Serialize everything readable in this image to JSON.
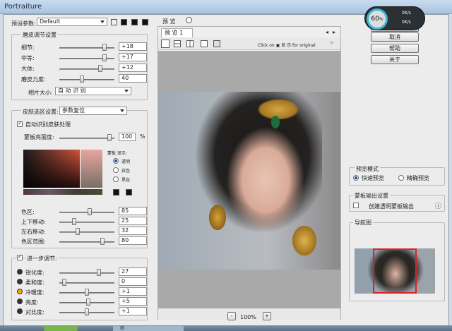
{
  "window": {
    "title": "Portraiture"
  },
  "preset": {
    "label": "预设参数:",
    "value": "Default"
  },
  "smoothing": {
    "title": "磨皮调节设置",
    "rows": [
      {
        "label": "细节:",
        "value": "+18",
        "pos": 0.85
      },
      {
        "label": "中等:",
        "value": "+17",
        "pos": 0.85
      },
      {
        "label": "大体:",
        "value": "+12",
        "pos": 0.76
      },
      {
        "label": "磨皮力度:",
        "value": "40",
        "pos": 0.4
      }
    ],
    "size_label": "相片大小:",
    "size_value": "自 动 识 别"
  },
  "skin": {
    "title": "皮肤选区设置:",
    "title_value": "参数复位",
    "auto_label": "自动识别皮肤处理",
    "opacity_label": "蒙板亮丽度:",
    "opacity_value": "100",
    "opacity_unit": "%",
    "mask_title": "蒙板 显示:",
    "mask_options": [
      "透明",
      "白色",
      "黑色"
    ],
    "rows": [
      {
        "label": "色区:",
        "value": "85",
        "pos": 0.55
      },
      {
        "label": "上下移动:",
        "value": "25",
        "pos": 0.25
      },
      {
        "label": "左右移动:",
        "value": "32",
        "pos": 0.32
      },
      {
        "label": "色区范围:",
        "value": "80",
        "pos": 0.8
      }
    ]
  },
  "enhance": {
    "title": "进一步调节:",
    "rows": [
      {
        "label": "锐化度:",
        "value": "27",
        "pos": 0.73,
        "icon": "contrast-icon"
      },
      {
        "label": "柔和度:",
        "value": "0",
        "pos": 0.05,
        "icon": "softness-icon"
      },
      {
        "label": "冷暖度:",
        "value": "+1",
        "pos": 0.5,
        "icon": "warmth-icon"
      },
      {
        "label": "亮度:",
        "value": "+5",
        "pos": 0.53,
        "icon": "brightness-icon"
      },
      {
        "label": "对比度:",
        "value": "+1",
        "pos": 0.5,
        "icon": "contrast2-icon"
      }
    ]
  },
  "preview": {
    "title": "预 览",
    "tab": "预 览 1",
    "click_text": "Click on",
    "click_text2": "显 示",
    "click_text3": "for original",
    "zoom": "100%",
    "minus": "-",
    "plus": "+"
  },
  "buttons": {
    "ok": "确定",
    "cancel": "取消",
    "help": "帮助",
    "about": "关于"
  },
  "preview_mode": {
    "title": "预览模式",
    "fast": "快速预览",
    "accurate": "精确预览"
  },
  "mask_output": {
    "title": "蒙板输出设置",
    "label": "创建透明蒙板输出"
  },
  "navigator": {
    "title": "导航图"
  },
  "net_widget": {
    "percent": "60",
    "unit": "%",
    "up": "0K/s",
    "down": "0K/s"
  },
  "taskbar": {
    "item": "印"
  }
}
